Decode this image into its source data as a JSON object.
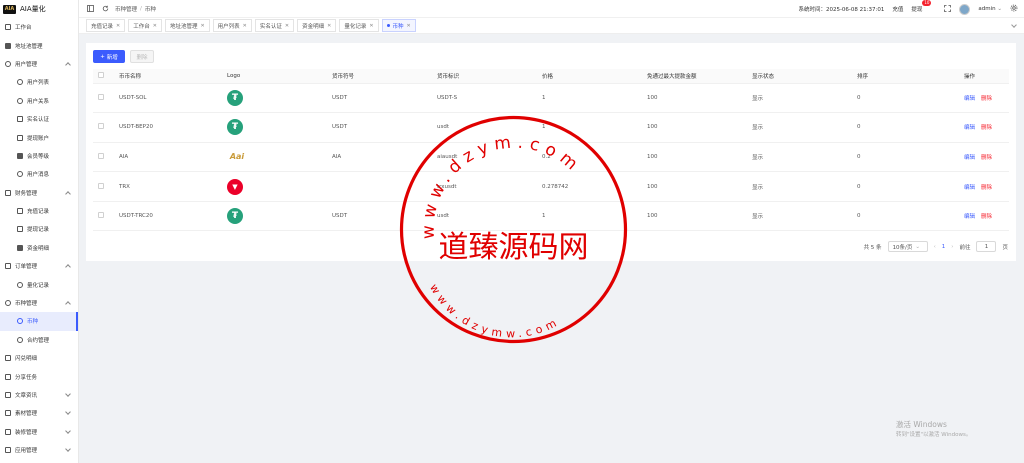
{
  "app": {
    "logo_mark": "AIA",
    "name": "AIA量化"
  },
  "sidebar": {
    "items": [
      {
        "label": "工作台",
        "icon": "monitor-icon",
        "level": 0,
        "arrow": ""
      },
      {
        "label": "地址池管理",
        "icon": "grid-icon",
        "level": 0,
        "arrow": ""
      },
      {
        "label": "用户管理",
        "icon": "user-icon",
        "level": 0,
        "arrow": "up"
      },
      {
        "label": "用户列表",
        "icon": "user-icon",
        "level": 1,
        "arrow": ""
      },
      {
        "label": "用户关系",
        "icon": "users-icon",
        "level": 1,
        "arrow": ""
      },
      {
        "label": "实名认证",
        "icon": "id-card-icon",
        "level": 1,
        "arrow": ""
      },
      {
        "label": "提现账户",
        "icon": "folder-icon",
        "level": 1,
        "arrow": ""
      },
      {
        "label": "会员等级",
        "icon": "rocket-icon",
        "level": 1,
        "arrow": ""
      },
      {
        "label": "用户消息",
        "icon": "message-icon",
        "level": 1,
        "arrow": ""
      },
      {
        "label": "财务管理",
        "icon": "chart-icon",
        "level": 0,
        "arrow": "up"
      },
      {
        "label": "充值记录",
        "icon": "folder-icon",
        "level": 1,
        "arrow": ""
      },
      {
        "label": "提现记录",
        "icon": "folder-icon",
        "level": 1,
        "arrow": ""
      },
      {
        "label": "资金明细",
        "icon": "bag-icon",
        "level": 1,
        "arrow": ""
      },
      {
        "label": "订单管理",
        "icon": "order-icon",
        "level": 0,
        "arrow": "up"
      },
      {
        "label": "量化记录",
        "icon": "clock-icon",
        "level": 1,
        "arrow": ""
      },
      {
        "label": "币种管理",
        "icon": "coins-icon",
        "level": 0,
        "arrow": "up"
      },
      {
        "label": "币种",
        "icon": "coins-icon",
        "level": 1,
        "arrow": "",
        "active": true
      },
      {
        "label": "合约管理",
        "icon": "globe-icon",
        "level": 1,
        "arrow": ""
      },
      {
        "label": "闪兑明细",
        "icon": "swap-icon",
        "level": 0,
        "arrow": ""
      },
      {
        "label": "分享任务",
        "icon": "gift-icon",
        "level": 0,
        "arrow": ""
      },
      {
        "label": "文章资讯",
        "icon": "article-icon",
        "level": 0,
        "arrow": "down"
      },
      {
        "label": "素材管理",
        "icon": "image-icon",
        "level": 0,
        "arrow": "down"
      },
      {
        "label": "装修管理",
        "icon": "brush-icon",
        "level": 0,
        "arrow": "down"
      },
      {
        "label": "应用管理",
        "icon": "app-icon",
        "level": 0,
        "arrow": "down"
      }
    ]
  },
  "topbar": {
    "breadcrumb": [
      "币种管理",
      "币种"
    ],
    "system_time_label": "系统时间：2025-06-08 21:37:01",
    "recharge": "充值",
    "withdraw": "提现",
    "withdraw_badge": "10",
    "user": "admin"
  },
  "tabs": [
    {
      "label": "充值记录",
      "active": false
    },
    {
      "label": "工作台",
      "active": false
    },
    {
      "label": "地址池管理",
      "active": false
    },
    {
      "label": "用户列表",
      "active": false
    },
    {
      "label": "实名认证",
      "active": false
    },
    {
      "label": "资金明细",
      "active": false
    },
    {
      "label": "量化记录",
      "active": false
    },
    {
      "label": "币种",
      "active": true
    }
  ],
  "toolbar": {
    "add_label": "新增",
    "delete_label": "删除"
  },
  "table": {
    "headers": [
      "币币名称",
      "Logo",
      "货币符号",
      "货币标识",
      "价格",
      "免通过最大提款金额",
      "显示状态",
      "排序",
      "操作"
    ],
    "rows": [
      {
        "name": "USDT-SOL",
        "logo": "usdt",
        "symbol": "USDT",
        "identifier": "USDT-S",
        "price": "1",
        "max": "100",
        "status": "显示",
        "sort": "0"
      },
      {
        "name": "USDT-BEP20",
        "logo": "usdt",
        "symbol": "USDT",
        "identifier": "usdt",
        "price": "1",
        "max": "100",
        "status": "显示",
        "sort": "0"
      },
      {
        "name": "AIA",
        "logo": "aia",
        "symbol": "AIA",
        "identifier": "aiausdt",
        "price": "0.2",
        "max": "100",
        "status": "显示",
        "sort": "0"
      },
      {
        "name": "TRX",
        "logo": "trx",
        "symbol": "",
        "identifier": "trxusdt",
        "price": "0.278742",
        "max": "100",
        "status": "显示",
        "sort": "0"
      },
      {
        "name": "USDT-TRC20",
        "logo": "usdt",
        "symbol": "USDT",
        "identifier": "usdt",
        "price": "1",
        "max": "100",
        "status": "显示",
        "sort": "0"
      }
    ],
    "edit_label": "编辑",
    "delete_label": "删除"
  },
  "pagination": {
    "total": "共 5 条",
    "page_size": "10条/页",
    "current": "1",
    "goto_label": "前往",
    "goto_value": "1",
    "page_suffix": "页"
  },
  "watermark": {
    "center": "道臻源码网",
    "top_ring": "www.dzym.com",
    "bottom_ring": "www.dzymw.com"
  },
  "windows_notice": {
    "line1": "激活 Windows",
    "line2": "转到\"设置\"以激活 Windows。"
  }
}
